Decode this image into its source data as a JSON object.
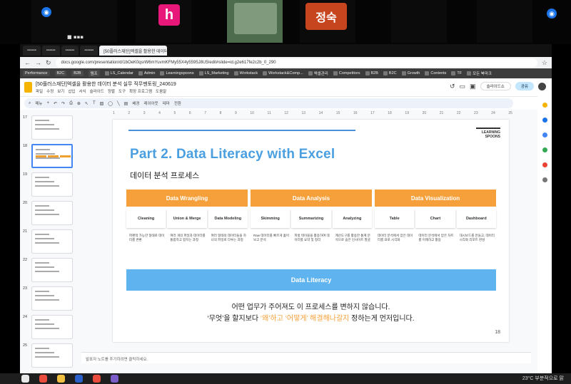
{
  "call": {
    "participants": [
      {
        "initial": "h",
        "color": "#e8177a"
      },
      {
        "initial": "정숙",
        "color": "#c7451e"
      }
    ]
  },
  "browser": {
    "url": "docs.google.com/presentation/d/1bOeK0qsrW6mYuvmKFMy55X4y5595J8U5/edit#slide=id.g2e617fe2c2b_0_290",
    "active_tab": "[50플러스재단]엑셀을 활용한 데이터 분석 실무",
    "bookmarks": [
      "Performance",
      "B2C",
      "B2B",
      "템프",
      "LS_Calendar",
      "Admin",
      "Learningspoons",
      "LS_Marketing",
      "Workstack",
      "Workstack&Comp...",
      "엑셀관리",
      "Competitors",
      "B2B",
      "B2C",
      "Growth",
      "Contents",
      "TF",
      "모든 북마크"
    ]
  },
  "app": {
    "doc_title": "[50플러스재단]엑셀을 활용한 데이터 분석 실무 직무멘토링_240619",
    "menus": [
      "파일",
      "수정",
      "보기",
      "삽입",
      "서식",
      "슬라이드",
      "정렬",
      "도구",
      "확장 프로그램",
      "도움말"
    ],
    "slideshow_label": "슬라이드쇼",
    "share_label": "공유",
    "toolbar_items": [
      "메뉴",
      "배경",
      "레이아웃",
      "테마",
      "전환"
    ],
    "notes_placeholder": "발표자 노트를 추가하려면 클릭하세요."
  },
  "filmstrip": {
    "numbers": [
      "17",
      "18",
      "19",
      "20",
      "21",
      "22",
      "23",
      "24",
      "25"
    ]
  },
  "slide": {
    "title": "Part 2. Data Literacy with Excel",
    "subtitle": "데이터 분석 프로세스",
    "brand_line1": "LEARNING",
    "brand_line2": "SPOONS",
    "columns": [
      {
        "header": "Data Wrangling",
        "subs": [
          "Cleaning",
          "Union & Merge",
          "Data Modeling"
        ],
        "descs": [
          "파편적 가능한 형태로 데이터를 변환",
          "여러 개의 파일과 데이터를 통합하고 합치는 과정",
          "여러 형태의 데이터들을 하나의 파일로 다루는 과정"
        ]
      },
      {
        "header": "Data Analysis",
        "subs": [
          "Skimming",
          "Summarizing",
          "Analyzing"
        ],
        "descs": [
          "Raw 데이터를 빠르게 훑어보고 분석",
          "피벗 테이블을 활용하여 데이터를 요약 및 정리",
          "계산도구를 활용한 통계 분석으로 숨은 인사이트 발굴"
        ]
      },
      {
        "header": "Data Visualization",
        "subs": [
          "Table",
          "Chart",
          "Dashboard"
        ],
        "descs": [
          "데이터 분석에서 얻은 데이터를 표로 시각화",
          "데이터 분석에서 얻은 차트를 이해하고 활용",
          "대시보드를 만들고, 데이터 시각화 리포트 완성"
        ]
      }
    ],
    "literacy_label": "Data Literacy",
    "closing_line1": "어떤 업무가 주어져도 이 프로세스를 변하지 않습니다.",
    "closing_line2_pre": "‘무엇’을 할지보다 ",
    "closing_line2_hl": "‘왜’하고 ‘어떻게’ 해결해나갈지",
    "closing_line2_post": " 정하는게 먼저입니다.",
    "page_number": "18"
  },
  "taskbar": {
    "tray": "23°C 부분적으로 맑"
  }
}
